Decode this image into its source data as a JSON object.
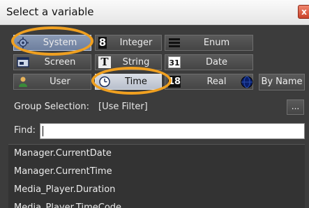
{
  "window": {
    "title": "Select a variable",
    "close_glyph": "x"
  },
  "type_buttons": [
    {
      "label": "System",
      "icon": "gear-icon",
      "state": "selected"
    },
    {
      "label": "Integer",
      "icon": "integer-icon",
      "state": "normal"
    },
    {
      "label": "Enum",
      "icon": "enum-icon",
      "state": "normal"
    },
    {
      "label": "Screen",
      "icon": "screen-icon",
      "state": "normal"
    },
    {
      "label": "String",
      "icon": "string-icon",
      "state": "normal"
    },
    {
      "label": "Date",
      "icon": "calendar-icon",
      "state": "normal"
    },
    {
      "label": "User",
      "icon": "user-icon",
      "state": "normal"
    },
    {
      "label": "Time",
      "icon": "clock-icon",
      "state": "pressed"
    },
    {
      "label": "Real",
      "icon": "real-icon",
      "state": "normal"
    }
  ],
  "icon_text": {
    "integer": "8",
    "string": "T",
    "date": "31",
    "real": "18"
  },
  "by_name_label": "By Name",
  "group_selection": {
    "label": "Group Selection:",
    "value": "[Use Filter]",
    "browse_label": "..."
  },
  "find": {
    "label": "Find:",
    "value": ""
  },
  "variables": [
    "Manager.CurrentDate",
    "Manager.CurrentTime",
    "Media_Player.Duration",
    "Media_Player.TimeCode"
  ],
  "colors": {
    "highlight_ring": "#f0a020",
    "selected_button": "#7b8cab",
    "dialog_background": "#3f3f3f"
  }
}
